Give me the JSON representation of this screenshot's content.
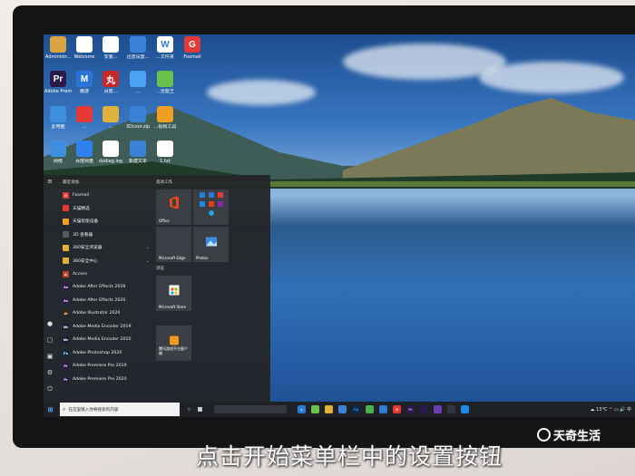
{
  "desktop": {
    "icons": [
      {
        "label": "Administr...",
        "color": "#d9a441",
        "glyph": ""
      },
      {
        "label": "Welcome",
        "color": "#ffffff",
        "glyph": ""
      },
      {
        "label": "安装...",
        "color": "#ffffff",
        "glyph": ""
      },
      {
        "label": "迅雷设置...",
        "color": "#3b82d6",
        "glyph": ""
      },
      {
        "label": "...文件夹",
        "color": "#ffffff",
        "glyph": "W"
      },
      {
        "label": "Foxmail",
        "color": "#e53935",
        "glyph": "G"
      },
      {
        "label": "Adobe Premiere...",
        "color": "#2a1a4a",
        "glyph": "Pr"
      },
      {
        "label": "傲游",
        "color": "#2b73d6",
        "glyph": "M"
      },
      {
        "label": "百度...",
        "color": "#c62828",
        "glyph": "丸"
      },
      {
        "label": "...",
        "color": "#4aa3f0",
        "glyph": ""
      },
      {
        "label": "...全能王",
        "color": "#6ac24a",
        "glyph": ""
      },
      {
        "label": "此电脑",
        "color": "#3f8fe0",
        "glyph": ""
      },
      {
        "label": "...",
        "color": "#e53935",
        "glyph": ""
      },
      {
        "label": "...",
        "color": "#e0b23a",
        "glyph": ""
      },
      {
        "label": "3Dcoor.zip",
        "color": "#3b82d6",
        "glyph": ""
      },
      {
        "label": "...视频工具",
        "color": "#f0a020",
        "glyph": ""
      },
      {
        "label": "网络",
        "color": "#3f8fe0",
        "glyph": ""
      },
      {
        "label": "百度网盘",
        "color": "#2f80ed",
        "glyph": ""
      },
      {
        "label": "dxdiag.log",
        "color": "#ffffff",
        "glyph": ""
      },
      {
        "label": "新建文本",
        "color": "#3b82d6",
        "glyph": ""
      },
      {
        "label": "1.txt",
        "color": "#ffffff",
        "glyph": ""
      }
    ]
  },
  "start_menu": {
    "recent_header": "最近添加",
    "apps": [
      {
        "label": "Foxmail",
        "color": "#e53935",
        "glyph": "G",
        "has_chevron": false
      },
      {
        "label": "天猫精选",
        "color": "#e53935",
        "glyph": "",
        "has_chevron": false
      },
      {
        "label": "天猫智能设备",
        "color": "#f0a020",
        "glyph": "",
        "has_chevron": false
      },
      {
        "label": "3D 查看器",
        "color": "#5b5b5b",
        "glyph": "",
        "has_chevron": false
      },
      {
        "label": "360安全浏览器",
        "color": "#e0b23a",
        "glyph": "",
        "has_chevron": true
      },
      {
        "label": "360安全中心",
        "color": "#e0b23a",
        "glyph": "",
        "has_chevron": true
      },
      {
        "label": "Access",
        "color": "#b7472a",
        "glyph": "A",
        "has_chevron": false
      },
      {
        "label": "Adobe After Effects 2019",
        "color": "#2a1a4a",
        "glyph": "Ae",
        "has_chevron": false
      },
      {
        "label": "Adobe After Effects 2020",
        "color": "#2a1a4a",
        "glyph": "Ae",
        "has_chevron": false
      },
      {
        "label": "Adobe Illustrator 2020",
        "color": "#3a2410",
        "glyph": "Ai",
        "has_chevron": false
      },
      {
        "label": "Adobe Media Encoder 2019",
        "color": "#1c1c3c",
        "glyph": "Me",
        "has_chevron": false
      },
      {
        "label": "Adobe Media Encoder 2020",
        "color": "#1c1c3c",
        "glyph": "Me",
        "has_chevron": false
      },
      {
        "label": "Adobe Photoshop 2020",
        "color": "#0b2a4a",
        "glyph": "Ps",
        "has_chevron": false
      },
      {
        "label": "Adobe Premiere Pro 2019",
        "color": "#2a1a4a",
        "glyph": "Pr",
        "has_chevron": false
      },
      {
        "label": "Adobe Premiere Pro 2020",
        "color": "#2a1a4a",
        "glyph": "Pr",
        "has_chevron": false
      }
    ],
    "tiles_header": "高效工作",
    "tiles": {
      "office": "Office",
      "edge": "Microsoft Edge",
      "photos": "Photos",
      "browse_header": "浏览",
      "store": "Microsoft Store",
      "maps": "腾讯游戏平台客户端"
    }
  },
  "taskbar": {
    "search_placeholder": "在这里输入你要搜索的内容",
    "weather": "13°C",
    "tray_text": "中"
  },
  "caption": "点击开始菜单栏中的设置按钮",
  "watermark": "天奇生活",
  "colors": {
    "start_bg": "#24262a",
    "taskbar_bg": "#1e2126",
    "tile_bg": "#3b3e44"
  }
}
